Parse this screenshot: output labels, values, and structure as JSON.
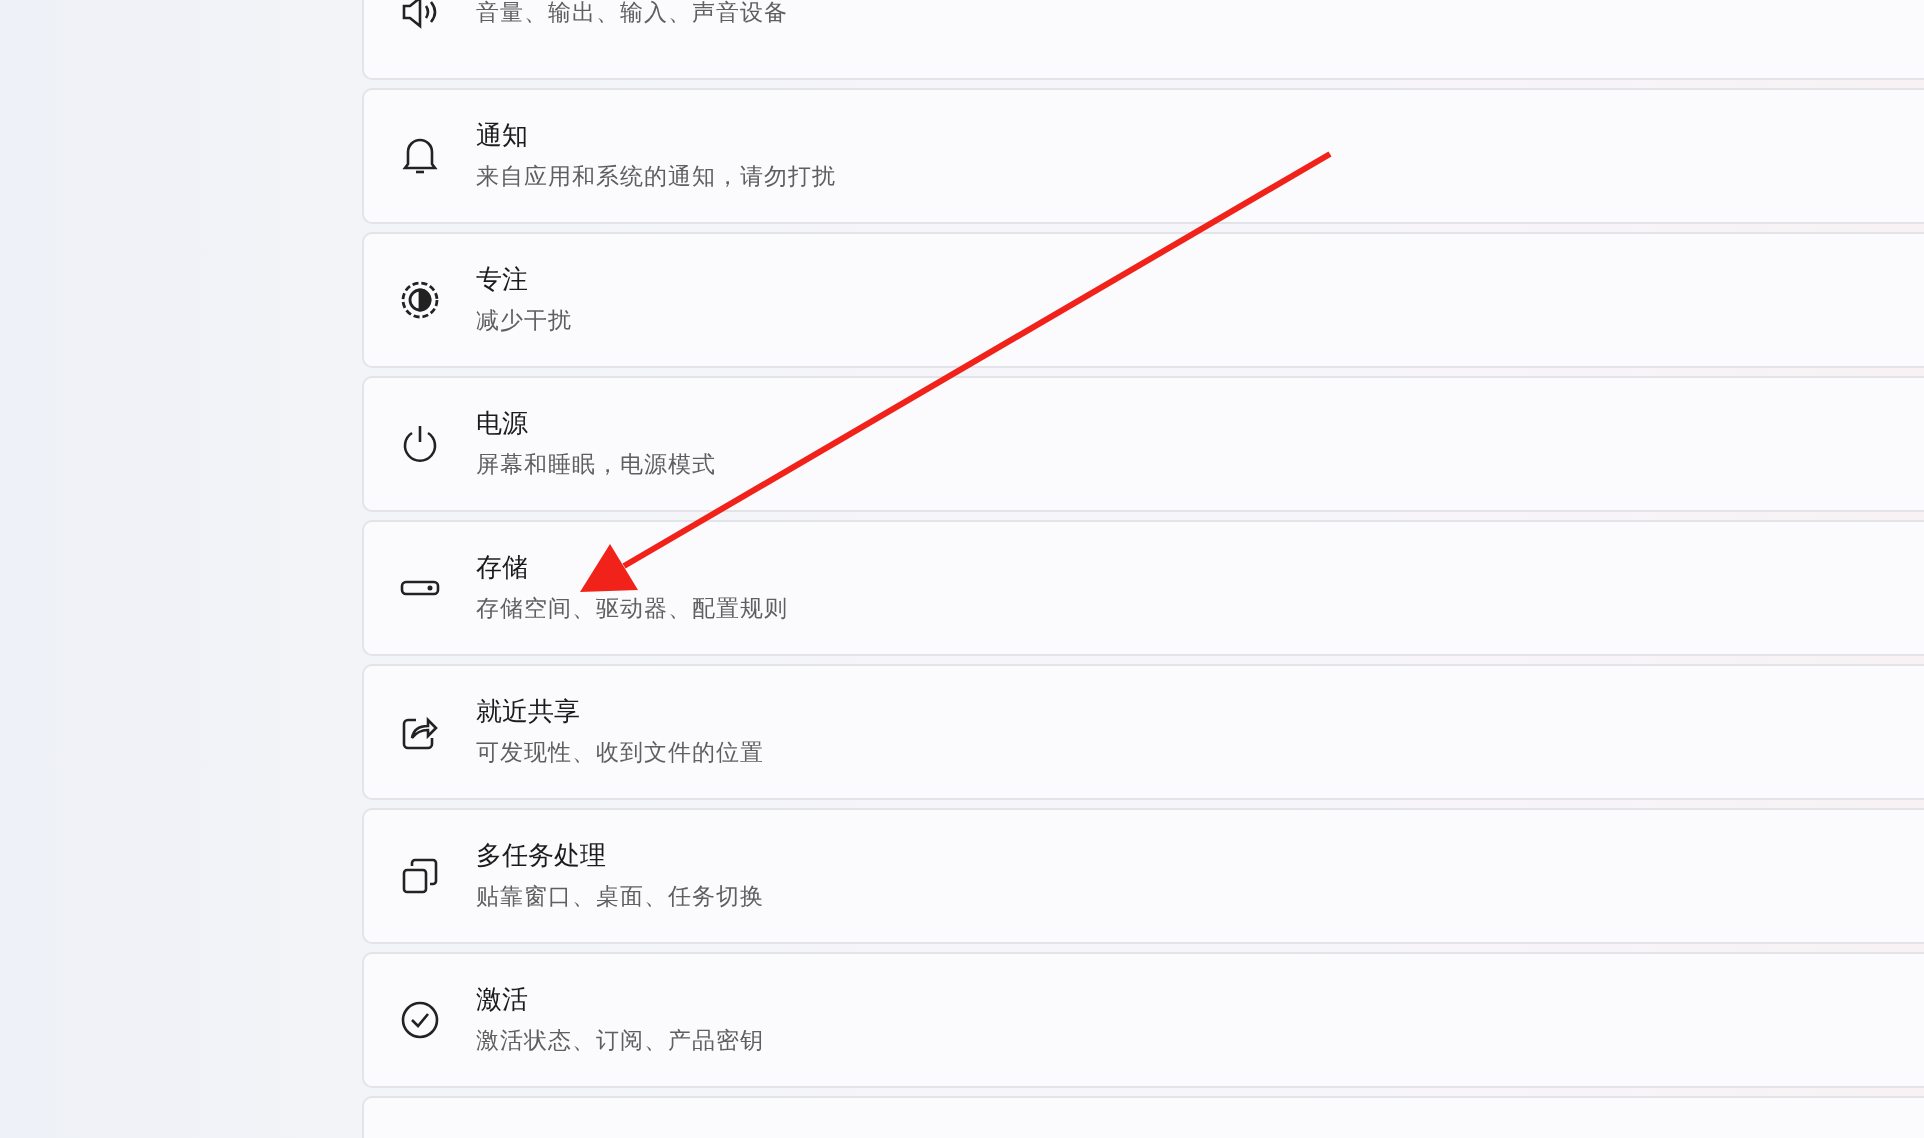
{
  "settings_list": [
    {
      "subtitle": "音量、输出、输入、声音设备"
    },
    {
      "title": "通知",
      "subtitle": "来自应用和系统的通知，请勿打扰"
    },
    {
      "title": "专注",
      "subtitle": "减少干扰"
    },
    {
      "title": "电源",
      "subtitle": "屏幕和睡眠，电源模式"
    },
    {
      "title": "存储",
      "subtitle": "存储空间、驱动器、配置规则"
    },
    {
      "title": "就近共享",
      "subtitle": "可发现性、收到文件的位置"
    },
    {
      "title": "多任务处理",
      "subtitle": "贴靠窗口、桌面、任务切换"
    },
    {
      "title": "激活",
      "subtitle": "激活状态、订阅、产品密钥"
    }
  ]
}
